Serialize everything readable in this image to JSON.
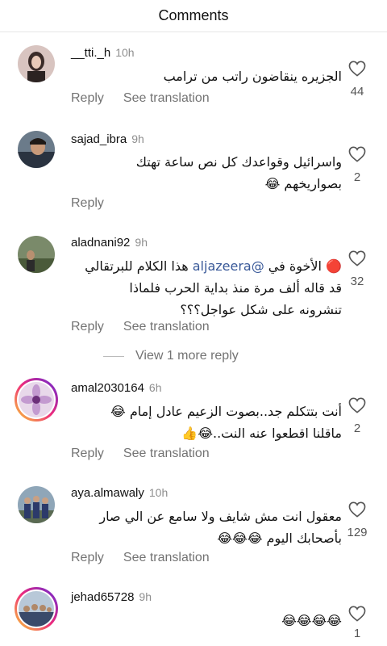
{
  "header": {
    "title": "Comments"
  },
  "actions": {
    "reply": "Reply",
    "translate": "See translation"
  },
  "view_more": "View 1 more reply",
  "comments": [
    {
      "username": "__tti._h",
      "time": "10h",
      "text": "الجزيره ينقاضون راتب من ترامب",
      "likes": "44"
    },
    {
      "username": "sajad_ibra",
      "time": "9h",
      "text": "واسرائيل وقواعدك كل نص ساعة تهتك بصواريخهم 😂",
      "likes": "2"
    },
    {
      "username": "aladnani92",
      "time": "9h",
      "text_before": "🔴 الأخوة في ",
      "mention": "@aljazeera",
      "text_after": " هذا الكلام للبرتقالي قد قاله ألف مرة منذ بداية الحرب فلماذا تنشرونه على شكل عواجل؟؟؟",
      "likes": "32"
    },
    {
      "username": "amal2030164",
      "time": "6h",
      "text": "أنت بتتكلم جد..بصوت الزعيم عادل إمام 😂 ماقلنا اقطعوا عنه النت..😂👍",
      "likes": "2"
    },
    {
      "username": "aya.almawaly",
      "time": "10h",
      "text": "معقول انت مش شايف ولا سامع عن الي صار بأصحابك اليوم 😂😂😂",
      "likes": "129"
    },
    {
      "username": "jehad65728",
      "time": "9h",
      "text": "😂😂😂😂",
      "likes": "1"
    }
  ],
  "colors": {
    "accent_link": "#385898",
    "muted": "#737373",
    "story_ring": "#c13584"
  }
}
